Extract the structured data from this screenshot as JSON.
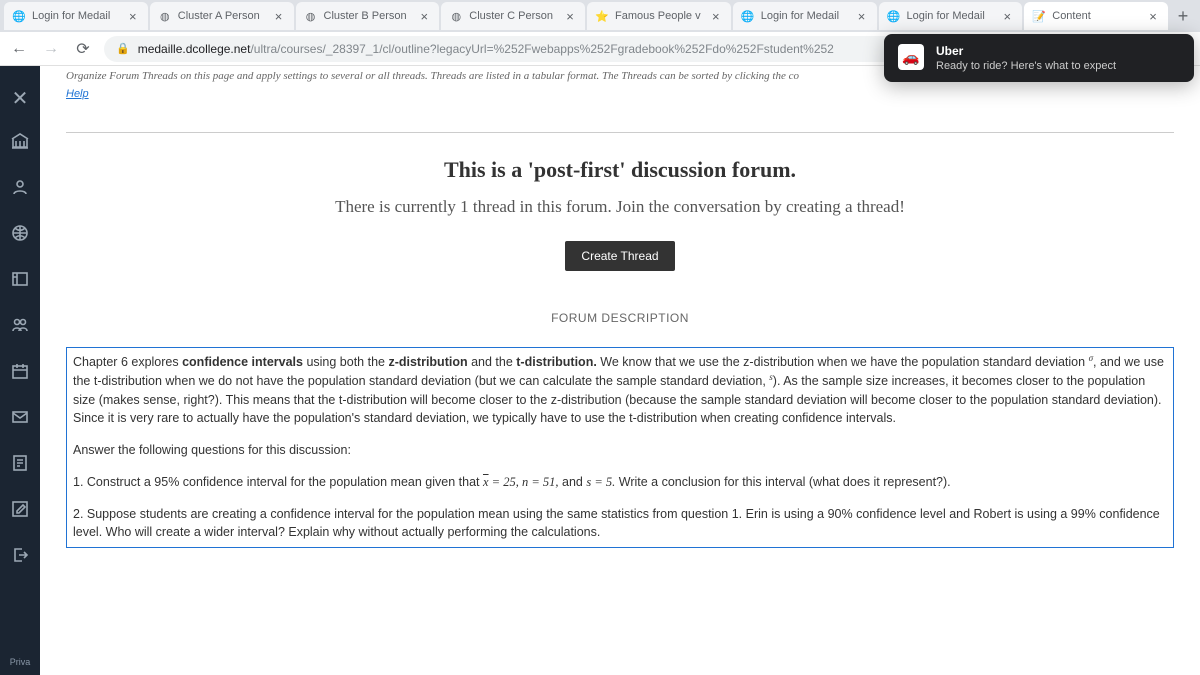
{
  "tabs": [
    {
      "title": "Login for Medail",
      "icon": "globe"
    },
    {
      "title": "Cluster A Person",
      "icon": "doc"
    },
    {
      "title": "Cluster B Person",
      "icon": "doc"
    },
    {
      "title": "Cluster C Person",
      "icon": "doc"
    },
    {
      "title": "Famous People v",
      "icon": "star"
    },
    {
      "title": "Login for Medail",
      "icon": "globe"
    },
    {
      "title": "Login for Medail",
      "icon": "globe"
    },
    {
      "title": "Content",
      "icon": "note",
      "active": true
    }
  ],
  "url": {
    "host": "medaille.dcollege.net",
    "path": "/ultra/courses/_28397_1/cl/outline?legacyUrl=%252Fwebapps%252Fgradebook%252Fdo%252Fstudent%252"
  },
  "notification": {
    "title": "Uber",
    "body": "Ready to ride? Here's what to expect"
  },
  "help_text": "Organize Forum Threads on this page and apply settings to several or all threads. Threads are listed in a tabular format. The Threads can be sorted by clicking the co",
  "help_link": "Help",
  "forum": {
    "heading": "This is a 'post-first' discussion forum.",
    "sub": "There is currently 1 thread in this forum. Join the conversation by creating a thread!",
    "create_btn": "Create Thread",
    "desc_label": "FORUM DESCRIPTION"
  },
  "description": {
    "p1a": "Chapter 6 explores ",
    "p1b": "confidence intervals",
    "p1c": " using both the ",
    "p1d": "z-distribution",
    "p1e": " and the ",
    "p1f": "t-distribution.",
    "p1g": " We know that we use the z-distribution when we have the population standard deviation ",
    "sigma": "σ",
    "p1h": ", and we use the t-distribution when we do not have the population standard deviation (but we can calculate the sample standard deviation, ",
    "s": "s",
    "p1i": "). As the sample size increases, it becomes closer to the population size (makes sense, right?). This means that the t-distribution will become closer to the z-distribution (because the sample standard deviation will become closer to the population standard deviation). Since it is very rare to actually have the population's standard deviation, we typically have to use the t-distribution when creating confidence intervals.",
    "p2": "Answer the following questions for this discussion:",
    "q1a": "1. Construct a 95% confidence interval for the population mean given that ",
    "q1_math1": "x̄ = 25, n = 51,",
    "q1b": " and ",
    "q1_math2": "s = 5.",
    "q1c": " Write a conclusion for this interval (what does it represent?).",
    "q2": "2. Suppose students are creating a confidence interval for the population mean using the same statistics from question 1. Erin is using a 90% confidence level and Robert is using a 99% confidence level. Who will create a wider interval? Explain why without actually performing the calculations."
  },
  "sidebar_footer": "Priva"
}
